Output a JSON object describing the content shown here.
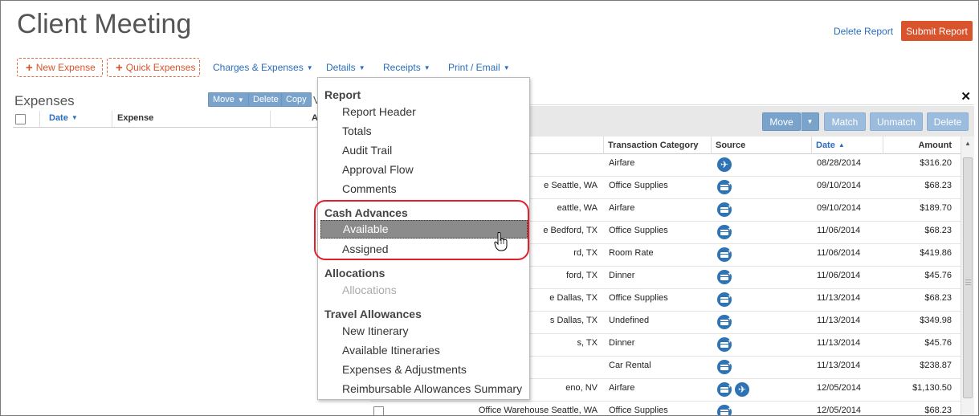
{
  "header": {
    "title": "Client Meeting",
    "delete_report": "Delete Report",
    "submit_report": "Submit Report"
  },
  "toolbar": {
    "new_expense": "New Expense",
    "quick_expenses": "Quick Expenses",
    "menus": [
      "Charges & Expenses",
      "Details",
      "Receipts",
      "Print / Email"
    ]
  },
  "expenses": {
    "title": "Expenses",
    "buttons": {
      "move": "Move",
      "delete": "Delete",
      "copy": "Copy"
    },
    "v_clip": "V",
    "columns": {
      "date": "Date",
      "expense": "Expense",
      "amount": "A"
    }
  },
  "panel": {
    "buttons": {
      "move": "Move",
      "match": "Match",
      "unmatch": "Unmatch",
      "delete": "Delete"
    },
    "columns": {
      "transaction_category": "Transaction Category",
      "source": "Source",
      "date": "Date",
      "amount": "Amount"
    },
    "rows": [
      {
        "vendor": "",
        "category": "Airfare",
        "source": [
          "plane-icon"
        ],
        "date": "08/28/2014",
        "amount": "$316.20"
      },
      {
        "vendor": "e Seattle, WA",
        "category": "Office Supplies",
        "source": [
          "card-icon"
        ],
        "date": "09/10/2014",
        "amount": "$68.23"
      },
      {
        "vendor": "eattle, WA",
        "category": "Airfare",
        "source": [
          "card-icon"
        ],
        "date": "09/10/2014",
        "amount": "$189.70"
      },
      {
        "vendor": "e Bedford, TX",
        "category": "Office Supplies",
        "source": [
          "card-icon"
        ],
        "date": "11/06/2014",
        "amount": "$68.23"
      },
      {
        "vendor": "rd, TX",
        "category": "Room Rate",
        "source": [
          "card-icon"
        ],
        "date": "11/06/2014",
        "amount": "$419.86"
      },
      {
        "vendor": "ford, TX",
        "category": "Dinner",
        "source": [
          "card-icon"
        ],
        "date": "11/06/2014",
        "amount": "$45.76"
      },
      {
        "vendor": "e Dallas, TX",
        "category": "Office Supplies",
        "source": [
          "card-icon"
        ],
        "date": "11/13/2014",
        "amount": "$68.23"
      },
      {
        "vendor": "s Dallas, TX",
        "category": "Undefined",
        "source": [
          "card-icon"
        ],
        "date": "11/13/2014",
        "amount": "$349.98"
      },
      {
        "vendor": "s, TX",
        "category": "Dinner",
        "source": [
          "card-icon"
        ],
        "date": "11/13/2014",
        "amount": "$45.76"
      },
      {
        "vendor": "",
        "category": "Car Rental",
        "source": [
          "card-icon"
        ],
        "date": "11/13/2014",
        "amount": "$238.87"
      },
      {
        "vendor": "eno, NV",
        "category": "Airfare",
        "source": [
          "card-icon",
          "plane-icon"
        ],
        "date": "12/05/2014",
        "amount": "$1,130.50"
      },
      {
        "vendor": "Office Warehouse Seattle, WA",
        "category": "Office Supplies",
        "source": [
          "card-icon"
        ],
        "date": "12/05/2014",
        "amount": "$68.23"
      }
    ]
  },
  "dropdown": {
    "sections": [
      {
        "heading": "Report",
        "items": [
          {
            "label": "Report Header"
          },
          {
            "label": "Totals"
          },
          {
            "label": "Audit Trail"
          },
          {
            "label": "Approval Flow"
          },
          {
            "label": "Comments"
          }
        ]
      },
      {
        "heading": "Cash Advances",
        "items": [
          {
            "label": "Available",
            "highlighted": true
          },
          {
            "label": "Assigned"
          }
        ]
      },
      {
        "heading": "Allocations",
        "items": [
          {
            "label": "Allocations",
            "disabled": true
          }
        ]
      },
      {
        "heading": "Travel Allowances",
        "items": [
          {
            "label": "New Itinerary"
          },
          {
            "label": "Available Itineraries"
          },
          {
            "label": "Expenses & Adjustments"
          },
          {
            "label": "Reimbursable Allowances Summary"
          }
        ]
      }
    ]
  },
  "colors": {
    "accent": "#2a6ebb",
    "submit": "#d9542c",
    "callout": "#e0202a",
    "button_blue": "#7aa3cc"
  }
}
